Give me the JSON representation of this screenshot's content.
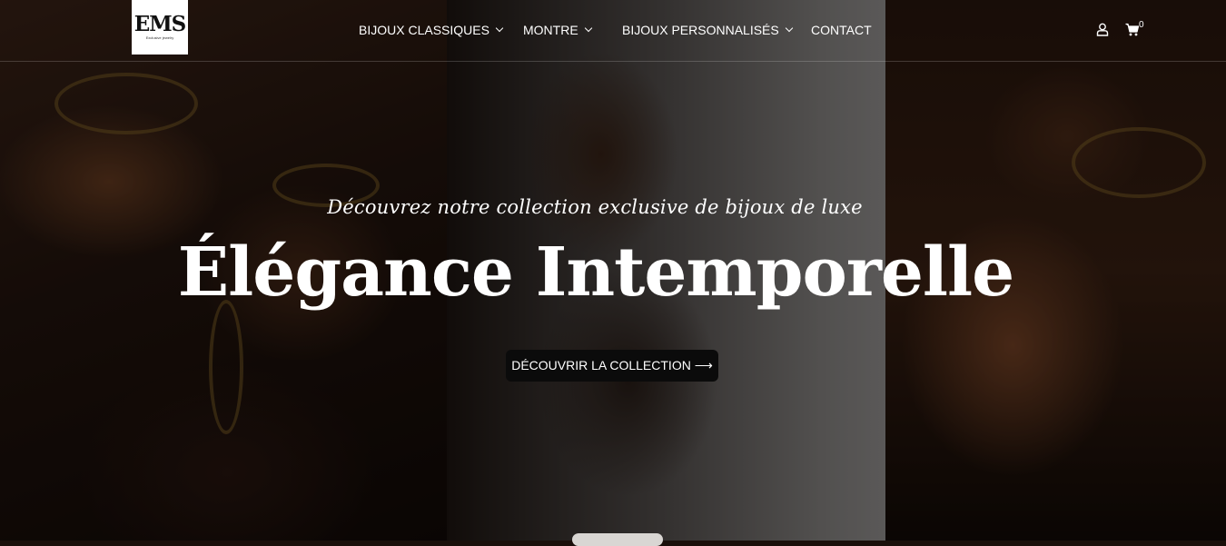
{
  "brand": {
    "logo_text": "EMS",
    "logo_sub": "Exclusive jewelry"
  },
  "nav": {
    "items": [
      {
        "label": "BIJOUX CLASSIQUES",
        "has_dropdown": true
      },
      {
        "label": "MONTRE",
        "has_dropdown": true
      },
      {
        "label": "BIJOUX PERSONNALISÉS",
        "has_dropdown": true
      },
      {
        "label": "CONTACT",
        "has_dropdown": false
      }
    ],
    "cart_count": "0"
  },
  "hero": {
    "subtitle": "Découvrez notre collection exclusive de bijoux de luxe",
    "title": "Élégance Intemporelle",
    "cta_label": "DÉCOUVRIR LA COLLECTION ⟶"
  },
  "icons": {
    "account": "user-icon",
    "cart": "cart-icon",
    "dropdown": "chevron-down-icon"
  },
  "colors": {
    "cta_bg": "#0b0b0b",
    "text": "#ffffff",
    "gold": "#8a6a2a"
  }
}
